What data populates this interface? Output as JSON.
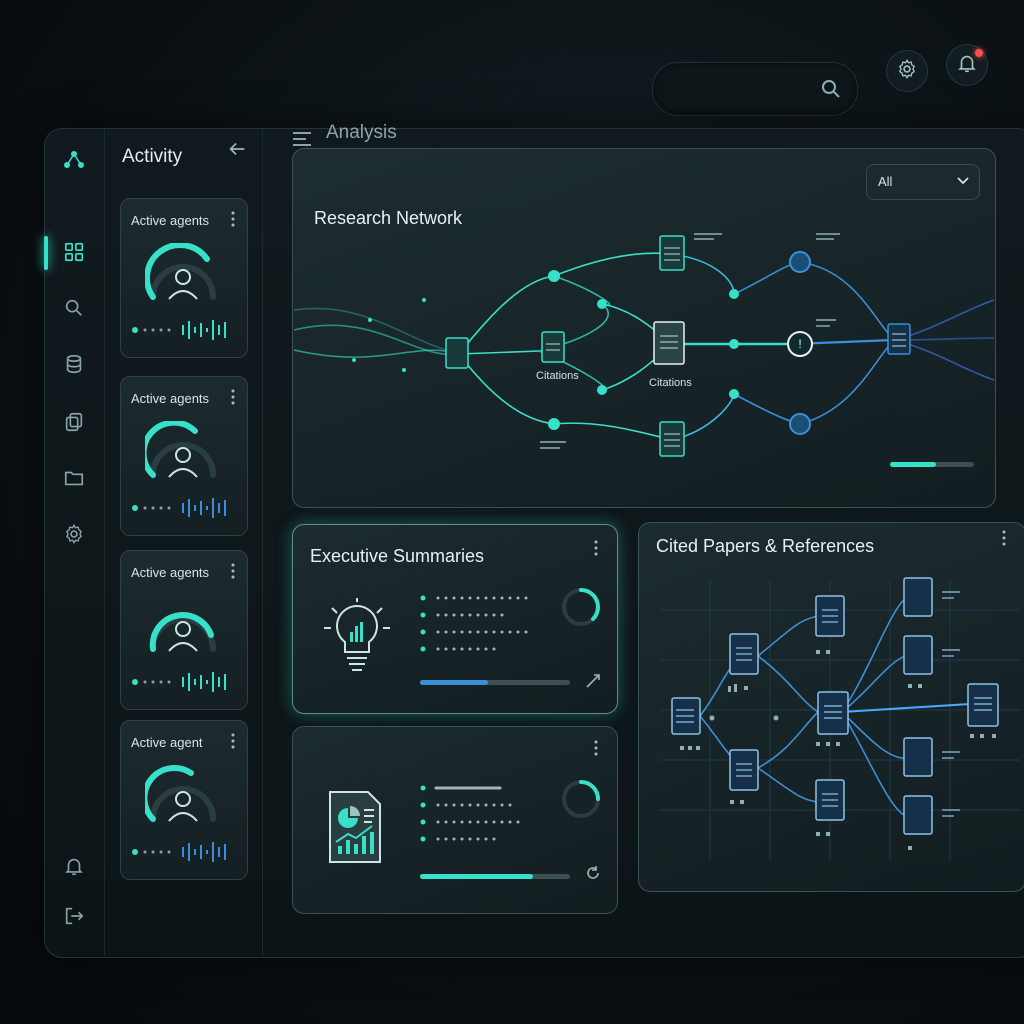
{
  "nav": {
    "section_title": "Activity",
    "rail_icons": [
      "logo-icon",
      "dashboard-icon",
      "search-icon",
      "database-icon",
      "copy-icon",
      "folder-icon",
      "gear-icon",
      "bell-icon",
      "logout-icon"
    ]
  },
  "header": {
    "title": "Analysis"
  },
  "agents": [
    {
      "label": "Active agents"
    },
    {
      "label": "Active agents"
    },
    {
      "label": "Active agents"
    },
    {
      "label": "Active agent"
    }
  ],
  "research_network": {
    "title": "Research Network",
    "filter_value": "All",
    "labels": [
      "Citations",
      "Citations"
    ]
  },
  "executive_summaries": {
    "title": "Executive Summaries",
    "progress": 0.45
  },
  "second_summary": {
    "progress": 0.75
  },
  "cited_papers": {
    "title": "Cited Papers & References"
  },
  "colors": {
    "accent": "#37e0c9",
    "accent_blue": "#3a8fd8",
    "notification": "#ff4d4d",
    "background": "#0b1114"
  }
}
